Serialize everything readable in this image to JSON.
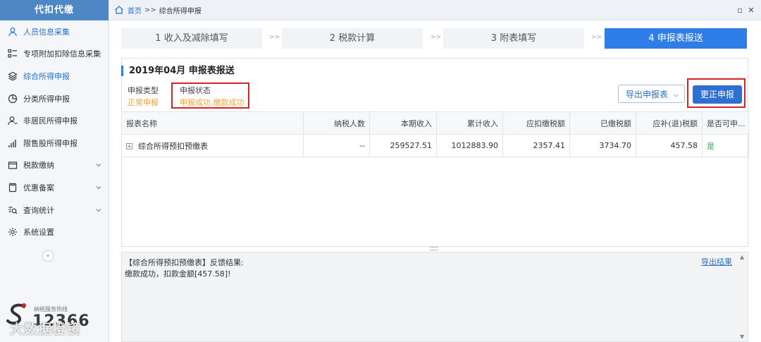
{
  "sidebar": {
    "title": "代扣代缴",
    "items": [
      {
        "label": "人员信息采集",
        "icon": "person-icon",
        "active": true
      },
      {
        "label": "专项附加扣除信息采集",
        "icon": "list-icon",
        "expandable": true
      },
      {
        "label": "综合所得申报",
        "icon": "layers-icon",
        "active": true
      },
      {
        "label": "分类所得申报",
        "icon": "pie-icon"
      },
      {
        "label": "非居民所得申报",
        "icon": "person-outline-icon"
      },
      {
        "label": "限售股所得申报",
        "icon": "bar-chart-icon"
      },
      {
        "label": "税款缴纳",
        "icon": "folder-icon",
        "expandable": true
      },
      {
        "label": "优惠备案",
        "icon": "document-icon",
        "expandable": true
      },
      {
        "label": "查询统计",
        "icon": "query-icon",
        "expandable": true
      },
      {
        "label": "系统设置",
        "icon": "gear-icon"
      }
    ],
    "collapse_glyph": "«",
    "hotline_label": "纳税服务热线",
    "hotline_number": "12366",
    "watermark": "大数据橙镜"
  },
  "topbar": {
    "home": "首页",
    "separator": ">>",
    "current": "综合所得申报",
    "restore": "▫",
    "close": "✕"
  },
  "steps": [
    {
      "label": "1 收入及减除填写",
      "active": false
    },
    {
      "label": "2 税款计算",
      "active": false
    },
    {
      "label": "3 附表填写",
      "active": false
    },
    {
      "label": "4 申报表报送",
      "active": true
    }
  ],
  "step_arrow": ">>",
  "main": {
    "period": "2019年04月 申报表报送",
    "filing_type_label": "申报类型",
    "filing_type_value": "正常申报",
    "filing_status_label": "申报状态",
    "filing_status_value": "申报成功,缴款成功",
    "export_button": "导出申报表",
    "correct_button": "更正申报"
  },
  "table": {
    "columns": [
      "报表名称",
      "纳税人数",
      "本期收入",
      "累计收入",
      "应扣缴税额",
      "已缴税额",
      "应补(退)税额",
      "是否可申..."
    ],
    "rows": [
      [
        "综合所得预扣预缴表",
        "--",
        "259527.51",
        "1012883.90",
        "2357.41",
        "3734.70",
        "457.58",
        "是"
      ]
    ]
  },
  "feedback": {
    "title": "【综合所得预扣预缴表】反馈结果:",
    "message": "缴款成功，扣款金额[457.58]!",
    "export_link": "导出结果"
  },
  "colors": {
    "primary": "#2f7ee8",
    "sidebar_header": "#4e87c6",
    "highlight_box": "#d6232a",
    "warning_text": "#f0a33c",
    "success_text": "#3aa75b"
  }
}
